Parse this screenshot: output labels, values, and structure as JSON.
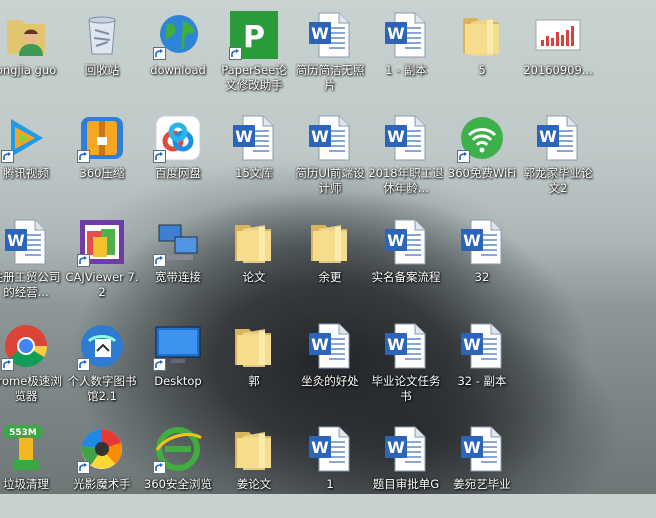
{
  "desktop": {
    "icons": [
      {
        "name": "user-folder",
        "kind": "user",
        "label": "ongjia guo",
        "shortcut": false
      },
      {
        "name": "recycle-bin",
        "kind": "recycle",
        "label": "回收站",
        "shortcut": false
      },
      {
        "name": "download",
        "kind": "globe",
        "label": "download",
        "shortcut": true
      },
      {
        "name": "papersee",
        "kind": "papersee",
        "label": "PaperSee论文修改助手",
        "shortcut": true
      },
      {
        "name": "resume-simple",
        "kind": "word",
        "label": "简历简洁无照片",
        "shortcut": false
      },
      {
        "name": "copy-1",
        "kind": "word",
        "label": "1 - 副本",
        "shortcut": false
      },
      {
        "name": "folder-5",
        "kind": "folder",
        "label": "5",
        "shortcut": false
      },
      {
        "name": "file-20160909",
        "kind": "image",
        "label": "20160909...",
        "shortcut": false
      },
      {
        "name": "tencent-video",
        "kind": "video",
        "label": "腾讯视频",
        "shortcut": true
      },
      {
        "name": "360-zip",
        "kind": "zip",
        "label": "360压缩",
        "shortcut": true
      },
      {
        "name": "baidu-pan",
        "kind": "baidu",
        "label": "百度网盘",
        "shortcut": true
      },
      {
        "name": "doc-15",
        "kind": "word",
        "label": "15文库",
        "shortcut": false
      },
      {
        "name": "resume-ui",
        "kind": "word",
        "label": "简历UI前端设计师",
        "shortcut": false
      },
      {
        "name": "doc-2018",
        "kind": "word",
        "label": "2018年职工退休年龄...",
        "shortcut": false
      },
      {
        "name": "wifi-360",
        "kind": "wifi",
        "label": "360免费WiFi",
        "shortcut": true
      },
      {
        "name": "guo-thesis",
        "kind": "word",
        "label": "郭龙家毕业论文2",
        "shortcut": false
      },
      {
        "name": "register-doc",
        "kind": "word",
        "label": "注册工贸公司的经营...",
        "shortcut": false
      },
      {
        "name": "cajviewer",
        "kind": "caj",
        "label": "CAJViewer 7.2",
        "shortcut": true
      },
      {
        "name": "broadband",
        "kind": "network",
        "label": "宽带连接",
        "shortcut": true
      },
      {
        "name": "folder-lunwen",
        "kind": "folder",
        "label": "论文",
        "shortcut": false
      },
      {
        "name": "folder-yugeng",
        "kind": "folder",
        "label": "余更",
        "shortcut": false
      },
      {
        "name": "filing-doc",
        "kind": "word",
        "label": "实名备案流程",
        "shortcut": false
      },
      {
        "name": "doc-32",
        "kind": "word",
        "label": "32",
        "shortcut": false
      },
      {
        "name": "chrome",
        "kind": "chrome",
        "label": "hrome极速浏览器",
        "shortcut": true
      },
      {
        "name": "digital-library",
        "kind": "library",
        "label": "个人数字图书馆2.1",
        "shortcut": true
      },
      {
        "name": "desktop-shortcut",
        "kind": "monitor",
        "label": "Desktop",
        "shortcut": true
      },
      {
        "name": "folder-guo",
        "kind": "folder",
        "label": "郭",
        "shortcut": false
      },
      {
        "name": "doc-zuojiu",
        "kind": "word",
        "label": "坐灸的好处",
        "shortcut": false
      },
      {
        "name": "thesis-service",
        "kind": "word",
        "label": "毕业论文任务书",
        "shortcut": false
      },
      {
        "name": "doc-32-copy",
        "kind": "word",
        "label": "32 - 副本",
        "shortcut": false
      },
      {
        "name": "trash-cleaner",
        "kind": "cleaner",
        "label": "垃圾清理",
        "badge": "553M",
        "shortcut": false
      },
      {
        "name": "photo-magic",
        "kind": "aperture",
        "label": "光影魔术手",
        "shortcut": true
      },
      {
        "name": "360-browser",
        "kind": "ie360",
        "label": "360安全浏览",
        "shortcut": true
      },
      {
        "name": "folder-jiang",
        "kind": "folder",
        "label": "姜论文",
        "shortcut": false
      },
      {
        "name": "doc-1",
        "kind": "word",
        "label": "1",
        "shortcut": false
      },
      {
        "name": "approval-doc",
        "kind": "word",
        "label": "题目审批单G",
        "shortcut": false
      },
      {
        "name": "jiang-thesis",
        "kind": "word",
        "label": "姜宛艺毕业",
        "shortcut": false
      }
    ]
  }
}
